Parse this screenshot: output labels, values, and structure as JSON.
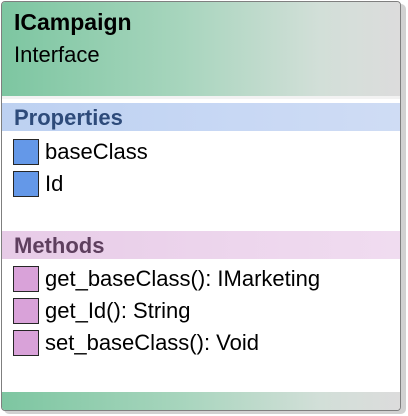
{
  "class": {
    "name": "ICampaign",
    "stereotype": "Interface"
  },
  "properties": {
    "title": "Properties",
    "items": [
      "baseClass",
      "Id"
    ]
  },
  "methods": {
    "title": "Methods",
    "items": [
      "get_baseClass(): IMarketing",
      "get_Id(): String",
      "set_baseClass(): Void"
    ]
  },
  "colors": {
    "header": "#7dc6a1",
    "properties_band": "#bdd1f1",
    "methods_band": "#e7cbe7",
    "property_icon": "#6498e8",
    "method_icon": "#d9a2d9"
  }
}
